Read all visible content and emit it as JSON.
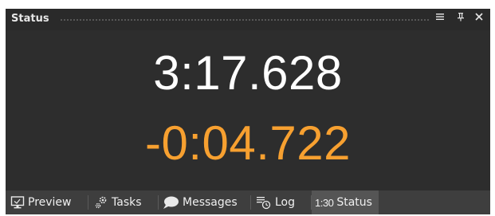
{
  "panel": {
    "title": "Status",
    "buttons": {
      "menu": "menu-icon",
      "pin": "pin-icon",
      "close": "close-icon"
    }
  },
  "timer": {
    "elapsed": "3:17.628",
    "remaining": "-0:04.722",
    "elapsed_color": "#ffffff",
    "remaining_color": "#f7a030"
  },
  "tabs": [
    {
      "label": "Preview",
      "icon": "monitor-icon"
    },
    {
      "label": "Tasks",
      "icon": "gears-icon"
    },
    {
      "label": "Messages",
      "icon": "speech-bubble-icon"
    },
    {
      "label": "Log",
      "icon": "log-clock-icon"
    },
    {
      "label": "Status",
      "prefix": "1:30",
      "active": true
    }
  ]
}
